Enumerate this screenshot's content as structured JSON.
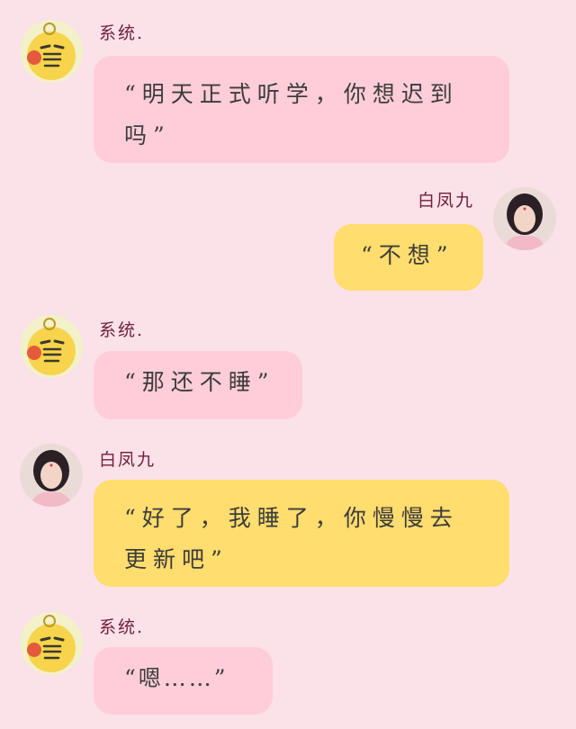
{
  "colors": {
    "background": "#fbe1e8",
    "name_text": "#6f1e3c",
    "bubble_pink": "#ffcdd9",
    "bubble_yellow": "#ffdd6e",
    "message_text": "#3c3c3c"
  },
  "messages": [
    {
      "sender": "系统.",
      "avatar": "yellow-meme-face-avatar",
      "align": "left",
      "text": "“明天正式听学，你想迟到吗”"
    },
    {
      "sender": "白凤九",
      "avatar": "girl-portrait-avatar",
      "align": "right",
      "text": "“不想”"
    },
    {
      "sender": "系统.",
      "avatar": "yellow-meme-face-avatar",
      "align": "left",
      "text": "“那还不睡”"
    },
    {
      "sender": "白凤九",
      "avatar": "girl-portrait-avatar",
      "align": "left",
      "text": "“好了，我睡了，你慢慢去更新吧”"
    },
    {
      "sender": "系统.",
      "avatar": "yellow-meme-face-avatar",
      "align": "left",
      "text": "“嗯……”"
    }
  ]
}
